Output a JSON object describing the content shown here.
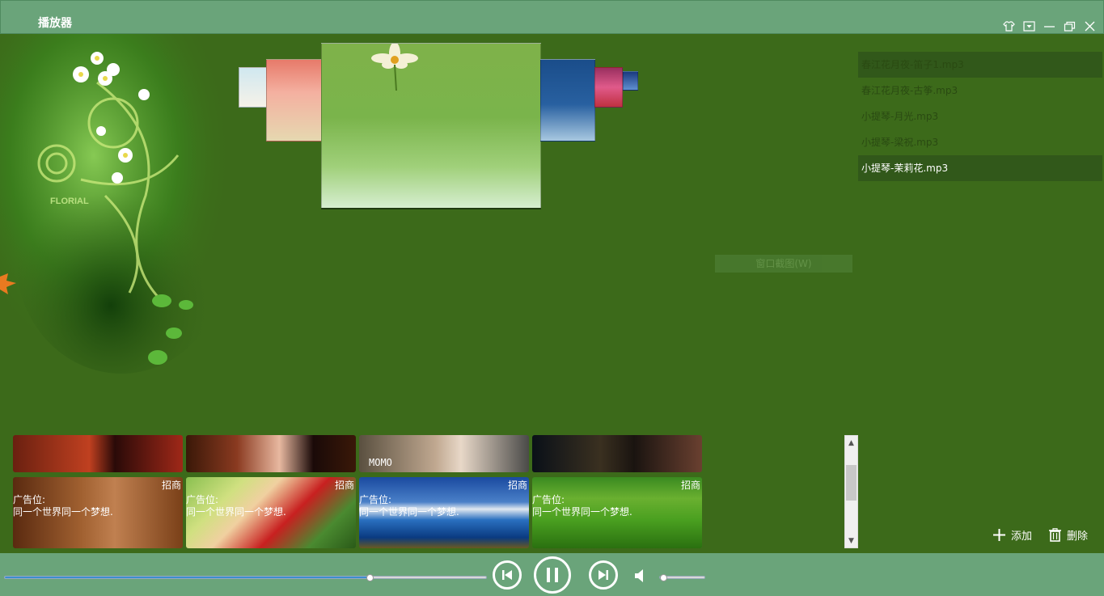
{
  "window": {
    "title": "播放器",
    "controls": [
      "skin-icon",
      "menu-dropdown-icon",
      "minimize-icon",
      "restore-icon",
      "close-icon"
    ]
  },
  "floral_art": {
    "label": "FLORIAL"
  },
  "playlist": {
    "items": [
      {
        "label": "春江花月夜-笛子1.mp3",
        "state": "dark"
      },
      {
        "label": "春江花月夜-古筝.mp3",
        "state": "normal"
      },
      {
        "label": "小提琴-月光.mp3",
        "state": "normal"
      },
      {
        "label": "小提琴-梁祝.mp3",
        "state": "normal"
      },
      {
        "label": "小提琴-茉莉花.mp3",
        "state": "current"
      }
    ],
    "add_label": "添加",
    "delete_label": "删除"
  },
  "tooltip": {
    "text": "窗口截图(W)"
  },
  "ads": {
    "strip_text": "MOMO",
    "cards": [
      {
        "tag": "招商",
        "title": "广告位:",
        "desc": "同一个世界同一个梦想."
      },
      {
        "tag": "招商",
        "title": "广告位:",
        "desc": "同一个世界同一个梦想."
      },
      {
        "tag": "招商",
        "title": "广告位:",
        "desc": "同一个世界同一个梦想."
      },
      {
        "tag": "招商",
        "title": "广告位:",
        "desc": "同一个世界同一个梦想."
      }
    ]
  },
  "playback": {
    "progress": 0.758,
    "volume": 0.08,
    "state": "playing"
  },
  "colors": {
    "titlebar": "#6aa47a",
    "body": "#3c6a1a",
    "playlist_active": "#31581a",
    "progress": "#3d8ed0"
  }
}
